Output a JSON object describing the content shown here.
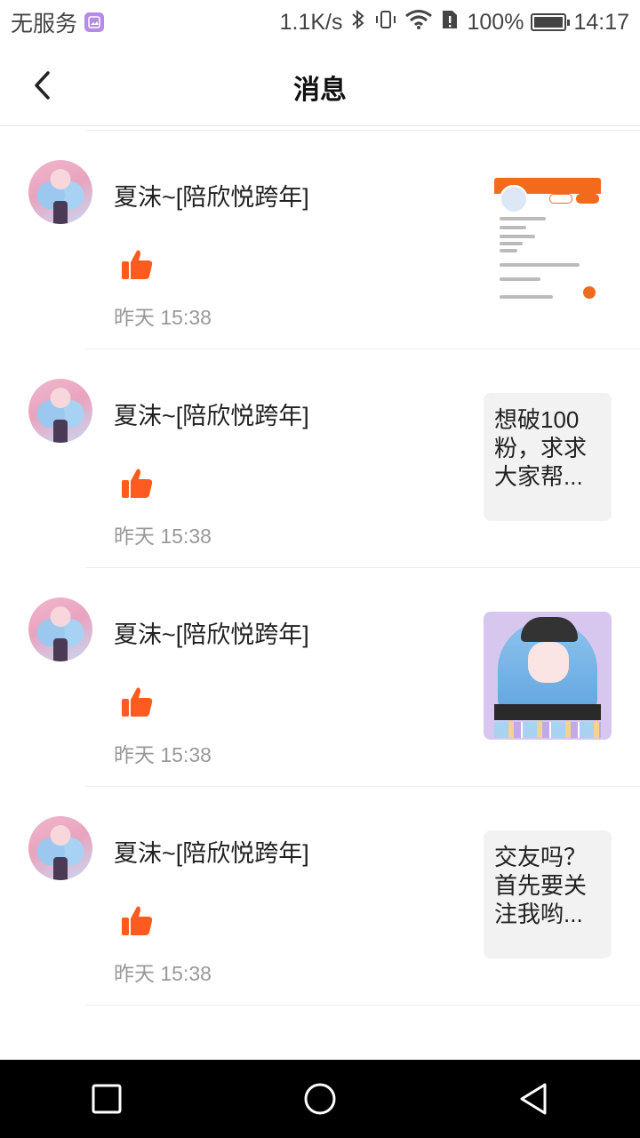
{
  "status_bar": {
    "carrier": "无服务",
    "speed": "1.1K/s",
    "battery": "100%",
    "time": "14:17"
  },
  "header": {
    "title": "消息"
  },
  "messages": [
    {
      "sender": "夏沫~[陪欣悦跨年]",
      "time": "昨天 15:38",
      "thumb_type": "image",
      "thumb_text": ""
    },
    {
      "sender": "夏沫~[陪欣悦跨年]",
      "time": "昨天 15:38",
      "thumb_type": "text",
      "thumb_text": "想破100\n粉，求求\n大家帮..."
    },
    {
      "sender": "夏沫~[陪欣悦跨年]",
      "time": "昨天 15:38",
      "thumb_type": "image",
      "thumb_text": ""
    },
    {
      "sender": "夏沫~[陪欣悦跨年]",
      "time": "昨天 15:38",
      "thumb_type": "text",
      "thumb_text": "交友吗？\n首先要关\n注我哟..."
    }
  ],
  "colors": {
    "accent": "#f26b1d",
    "like_icon": "#ff5a1f"
  }
}
